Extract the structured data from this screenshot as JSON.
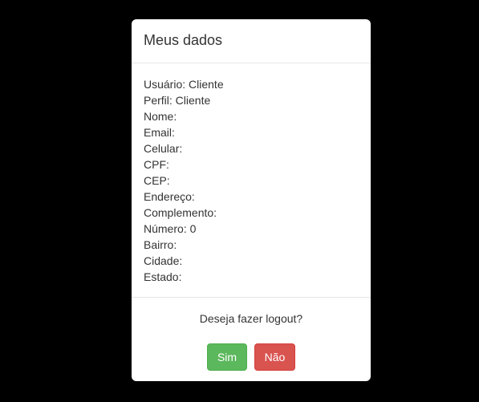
{
  "modal": {
    "title": "Meus dados",
    "fields": [
      "Usuário: Cliente",
      "Perfil: Cliente",
      "Nome:",
      "Email:",
      "Celular:",
      "CPF:",
      "CEP:",
      "Endereço:",
      "Complemento:",
      "Número: 0",
      "Bairro:",
      "Cidade:",
      "Estado:"
    ],
    "question": "Deseja fazer logout?",
    "yes_label": "Sim",
    "no_label": "Não"
  },
  "colors": {
    "backdrop": "#000000",
    "yes_button": "#5cb85c",
    "no_button": "#d9534f"
  }
}
